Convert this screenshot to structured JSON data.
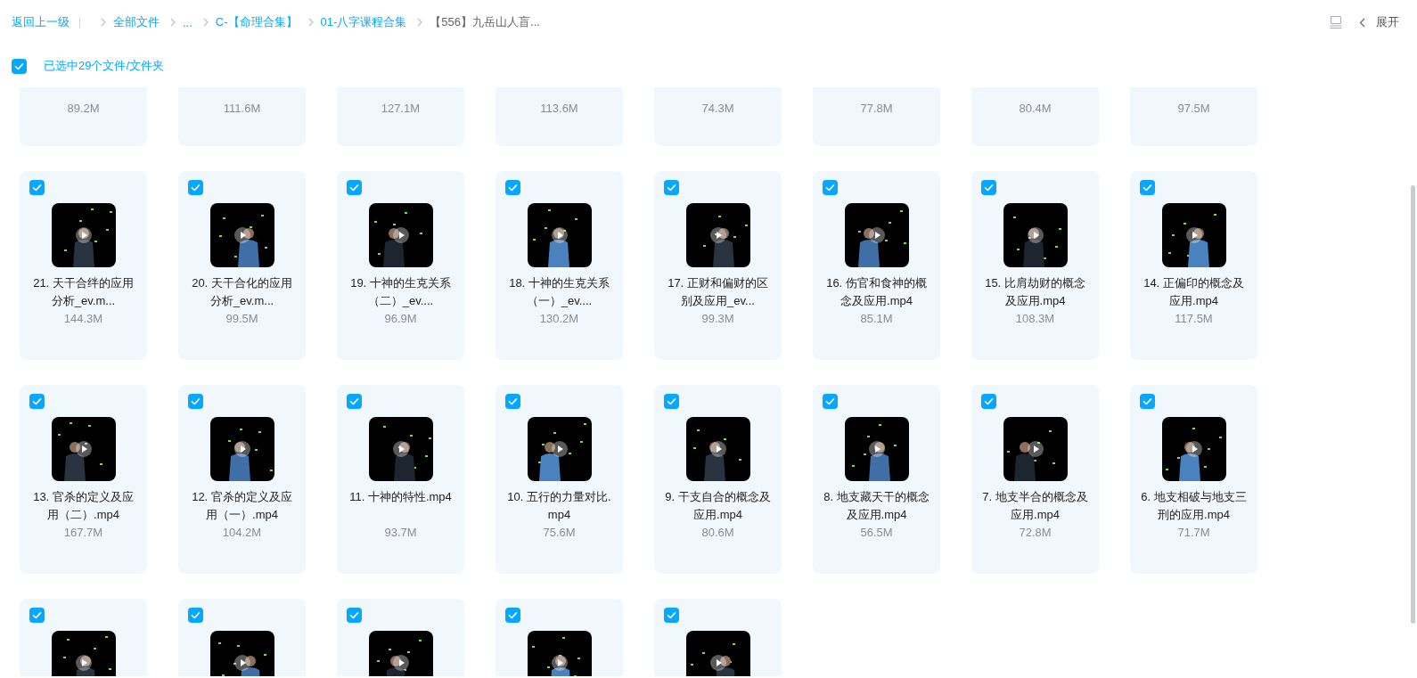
{
  "breadcrumb": {
    "back": "返回上一级",
    "items": [
      {
        "label": "全部文件",
        "current": false
      },
      {
        "label": "...",
        "current": false
      },
      {
        "label": "C-【命理合集】",
        "current": false
      },
      {
        "label": "01-八字课程合集",
        "current": false
      },
      {
        "label": "【556】九岳山人盲...",
        "current": true
      }
    ]
  },
  "toolbar": {
    "expand": "展开"
  },
  "selection": {
    "checked": true,
    "label": "已选中29个文件/文件夹"
  },
  "files": [
    {
      "kind": "partial",
      "size": "89.2M"
    },
    {
      "kind": "partial",
      "size": "111.6M"
    },
    {
      "kind": "partial",
      "size": "127.1M"
    },
    {
      "kind": "partial",
      "size": "113.6M"
    },
    {
      "kind": "partial",
      "size": "74.3M"
    },
    {
      "kind": "partial",
      "size": "77.8M"
    },
    {
      "kind": "partial",
      "size": "80.4M"
    },
    {
      "kind": "partial",
      "size": "97.5M"
    },
    {
      "kind": "full",
      "checked": true,
      "name": "21. 天干合绊的应用分析_ev.m...",
      "size": "144.3M"
    },
    {
      "kind": "full",
      "checked": true,
      "name": "20. 天干合化的应用分析_ev.m...",
      "size": "99.5M"
    },
    {
      "kind": "full",
      "checked": true,
      "name": "19. 十神的生克关系（二）_ev....",
      "size": "96.9M"
    },
    {
      "kind": "full",
      "checked": true,
      "name": "18. 十神的生克关系（一）_ev....",
      "size": "130.2M"
    },
    {
      "kind": "full",
      "checked": true,
      "name": "17. 正财和偏财的区别及应用_ev...",
      "size": "99.3M"
    },
    {
      "kind": "full",
      "checked": true,
      "name": "16. 伤官和食神的概念及应用.mp4",
      "size": "85.1M"
    },
    {
      "kind": "full",
      "checked": true,
      "name": "15. 比肩劫财的概念及应用.mp4",
      "size": "108.3M"
    },
    {
      "kind": "full",
      "checked": true,
      "name": "14. 正偏印的概念及应用.mp4",
      "size": "117.5M"
    },
    {
      "kind": "full",
      "checked": true,
      "name": "13. 官杀的定义及应用（二）.mp4",
      "size": "167.7M"
    },
    {
      "kind": "full",
      "checked": true,
      "name": "12. 官杀的定义及应用（一）.mp4",
      "size": "104.2M"
    },
    {
      "kind": "full",
      "checked": true,
      "name": "11. 十神的特性.mp4",
      "size": "93.7M"
    },
    {
      "kind": "full",
      "checked": true,
      "name": "10. 五行的力量对比.mp4",
      "size": "75.6M"
    },
    {
      "kind": "full",
      "checked": true,
      "name": "9. 干支自合的概念及应用.mp4",
      "size": "80.6M"
    },
    {
      "kind": "full",
      "checked": true,
      "name": "8. 地支藏天干的概念及应用.mp4",
      "size": "56.5M"
    },
    {
      "kind": "full",
      "checked": true,
      "name": "7. 地支半合的概念及应用.mp4",
      "size": "72.8M"
    },
    {
      "kind": "full",
      "checked": true,
      "name": "6. 地支相破与地支三刑的应用.mp4",
      "size": "71.7M"
    },
    {
      "kind": "cut",
      "checked": true
    },
    {
      "kind": "cut",
      "checked": true
    },
    {
      "kind": "cut",
      "checked": true
    },
    {
      "kind": "cut",
      "checked": true
    },
    {
      "kind": "cut",
      "checked": true
    }
  ]
}
